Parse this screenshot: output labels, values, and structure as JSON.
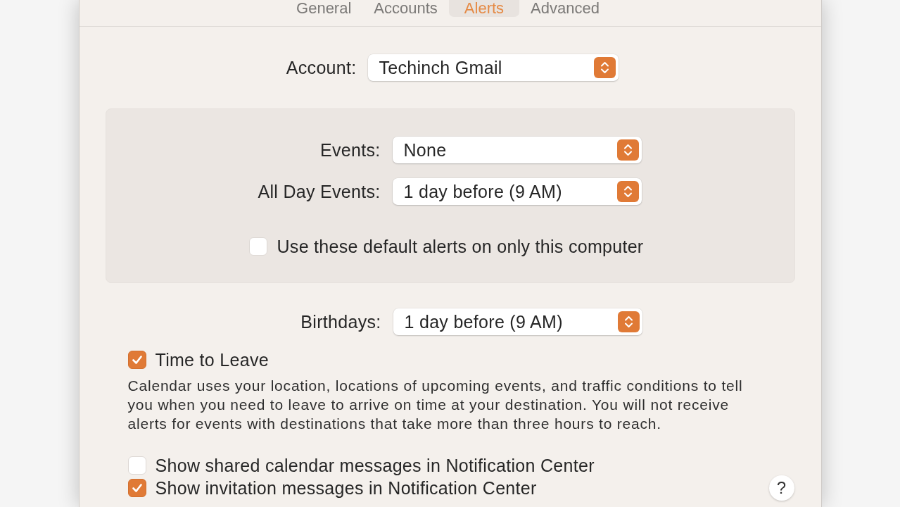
{
  "tabs": [
    {
      "label": "General",
      "selected": false
    },
    {
      "label": "Accounts",
      "selected": false
    },
    {
      "label": "Alerts",
      "selected": true
    },
    {
      "label": "Advanced",
      "selected": false
    }
  ],
  "account": {
    "label": "Account:",
    "value": "Techinch Gmail"
  },
  "default_alerts": {
    "rows": [
      {
        "label": "Events:",
        "value": "None"
      },
      {
        "label": "All Day Events:",
        "value": "1 day before (9 AM)"
      }
    ],
    "checkbox": {
      "label": "Use these default alerts on only this computer",
      "checked": false
    }
  },
  "birthdays": {
    "label": "Birthdays:",
    "value": "1 day before (9 AM)"
  },
  "time_to_leave": {
    "label": "Time to Leave",
    "checked": true,
    "description": "Calendar uses your location, locations of upcoming events, and traffic conditions to tell you when you need to leave to arrive on time at your destination. You will not receive alerts for events with destinations that take more than three hours to reach."
  },
  "options": [
    {
      "label": "Show shared calendar messages in Notification Center",
      "checked": false
    },
    {
      "label": "Show invitation messages in Notification Center",
      "checked": true
    }
  ],
  "help_button": {
    "label": "?"
  }
}
